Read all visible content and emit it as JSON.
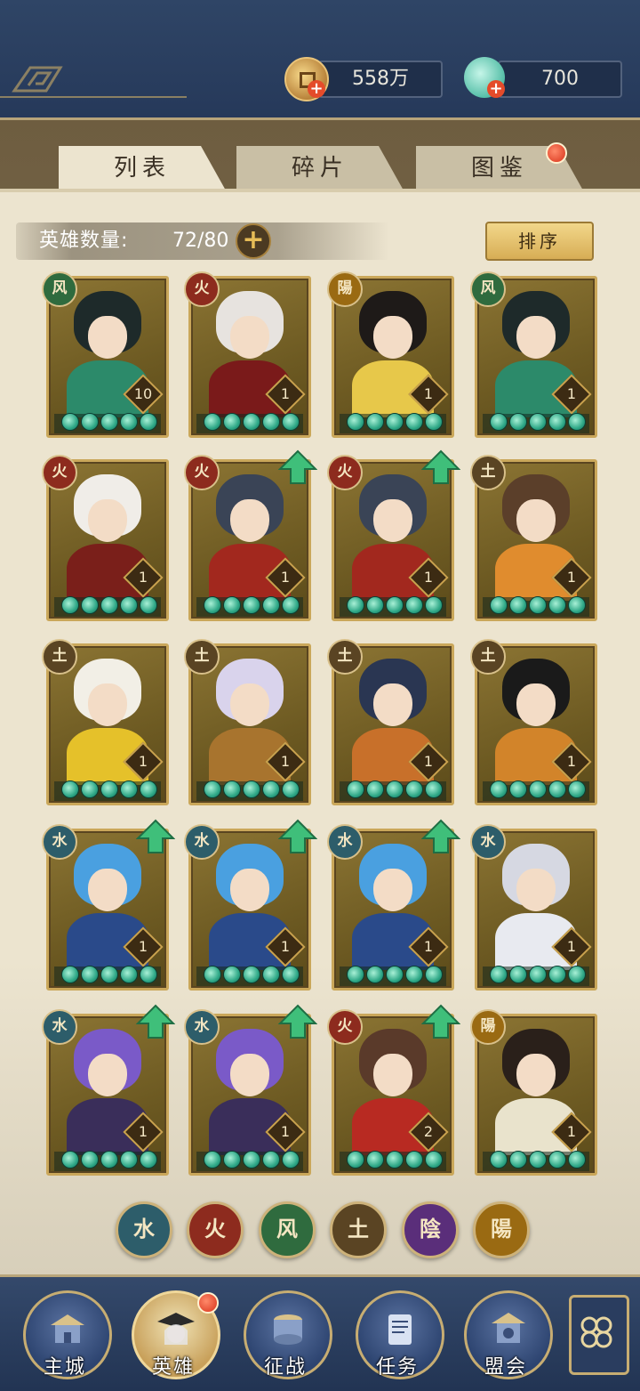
{
  "resources": {
    "coins": "558万",
    "jade": "700"
  },
  "tabs": [
    {
      "label": "列表"
    },
    {
      "label": "碎片"
    },
    {
      "label": "图鉴"
    }
  ],
  "hero_count": {
    "label": "英雄数量:",
    "value": "72/80"
  },
  "sort_label": "排序",
  "heroes": [
    {
      "element": "风",
      "level": "10",
      "hair": "#1e2a2a",
      "body": "#2c8a6a",
      "upgrade": false
    },
    {
      "element": "火",
      "level": "1",
      "hair": "#e7e3df",
      "body": "#7a1a1a",
      "upgrade": false
    },
    {
      "element": "陽",
      "level": "1",
      "hair": "#1e1a18",
      "body": "#e7c84a",
      "upgrade": false
    },
    {
      "element": "风",
      "level": "1",
      "hair": "#1e2a2a",
      "body": "#2c8a6a",
      "upgrade": false
    },
    {
      "element": "火",
      "level": "1",
      "hair": "#f0ede8",
      "body": "#7a1f1a",
      "upgrade": false
    },
    {
      "element": "火",
      "level": "1",
      "hair": "#3a4456",
      "body": "#a2281e",
      "upgrade": true
    },
    {
      "element": "火",
      "level": "1",
      "hair": "#3a4456",
      "body": "#a2281e",
      "upgrade": true
    },
    {
      "element": "土",
      "level": "1",
      "hair": "#5b3f2a",
      "body": "#e08c2e",
      "upgrade": false
    },
    {
      "element": "土",
      "level": "1",
      "hair": "#f2efe6",
      "body": "#e5c12a",
      "upgrade": false
    },
    {
      "element": "土",
      "level": "1",
      "hair": "#d9d3ec",
      "body": "#a8742e",
      "upgrade": false
    },
    {
      "element": "土",
      "level": "1",
      "hair": "#2a3652",
      "body": "#c8702a",
      "upgrade": false
    },
    {
      "element": "土",
      "level": "1",
      "hair": "#1a1a1a",
      "body": "#d2842a",
      "upgrade": false
    },
    {
      "element": "水",
      "level": "1",
      "hair": "#4aa0e0",
      "body": "#2a4a8a",
      "upgrade": true
    },
    {
      "element": "水",
      "level": "1",
      "hair": "#4aa0e0",
      "body": "#2a4a8a",
      "upgrade": true
    },
    {
      "element": "水",
      "level": "1",
      "hair": "#4aa0e0",
      "body": "#2a4a8a",
      "upgrade": true
    },
    {
      "element": "水",
      "level": "1",
      "hair": "#d6d8e2",
      "body": "#e8eaf0",
      "upgrade": false
    },
    {
      "element": "水",
      "level": "1",
      "hair": "#7a5ac8",
      "body": "#3a2e5a",
      "upgrade": true
    },
    {
      "element": "水",
      "level": "1",
      "hair": "#7a5ac8",
      "body": "#3a2e5a",
      "upgrade": true
    },
    {
      "element": "火",
      "level": "2",
      "hair": "#5a3a2a",
      "body": "#b82a22",
      "upgrade": true
    },
    {
      "element": "陽",
      "level": "1",
      "hair": "#2a201a",
      "body": "#e9e3cc",
      "upgrade": false
    }
  ],
  "filters": [
    "水",
    "火",
    "风",
    "土",
    "陰",
    "陽"
  ],
  "nav": [
    {
      "label": "主城"
    },
    {
      "label": "英雄"
    },
    {
      "label": "征战"
    },
    {
      "label": "任务"
    },
    {
      "label": "盟会"
    }
  ]
}
